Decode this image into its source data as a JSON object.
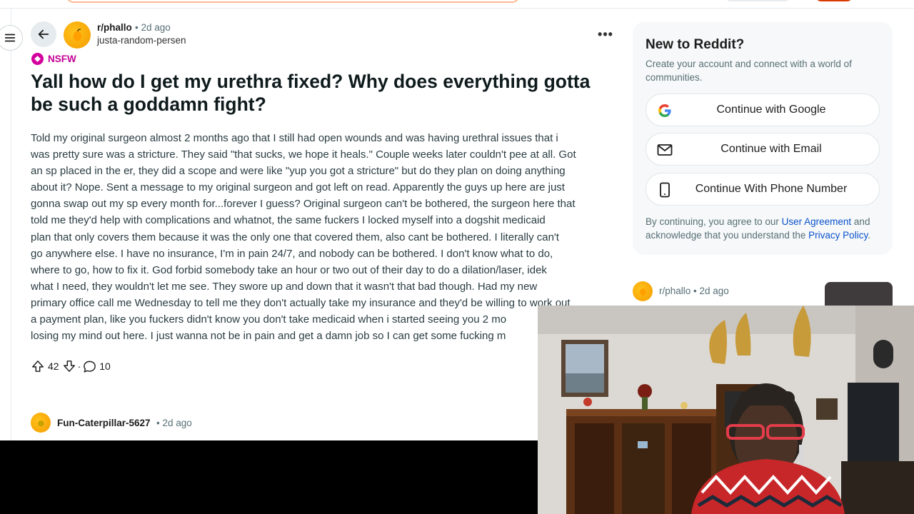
{
  "post": {
    "subreddit": "r/phallo",
    "time": "• 2d ago",
    "author": "justa-random-persen",
    "flair": "NSFW",
    "title": "Yall how do I get my urethra fixed? Why does everything gotta be such a goddamn fight?",
    "body": [
      "Told my original surgeon almost 2 months ago that I still had open wounds and was having urethral issues that i",
      "was pretty sure was a stricture. They said \"that sucks, we hope it heals.\" Couple weeks later couldn't pee at all. Got",
      "an sp placed in the er, they did a scope and were like \"yup you got a stricture\" but do they plan on doing anything",
      "about it? Nope. Sent a message to my original surgeon and got left on read. Apparently the guys up here are just",
      "gonna swap out my sp every month for...forever I guess? Original surgeon can't be bothered, the surgeon here that",
      "told me they'd help with complications and whatnot, the same fuckers I locked myself into a dogshit medicaid",
      "plan that only covers them because it was the only one that covered them, also cant be bothered. I literally can't",
      "go anywhere else. I have no insurance, I'm in pain 24/7, and nobody can be bothered. I don't know what to do,",
      "where to go, how to fix it. God forbid somebody take an hour or two out of their day to do a dilation/laser, idek",
      "what I need, they wouldn't let me see. They swore up and down that it wasn't that bad though. Had my new",
      "primary office call me Wednesday to tell me they don't actually take my insurance and they'd be willing to work out",
      "a payment plan, like you fuckers didn't know you don't take medicaid when i started seeing you 2 mo",
      "losing my mind out here. I just wanna not be in pain and get a damn job so I can get some fucking m"
    ],
    "votes": "42",
    "comments": "10",
    "separator": "·"
  },
  "comment": {
    "user": "Fun-Caterpillar-5627",
    "time": "• 2d ago"
  },
  "sidebar": {
    "title": "New to Reddit?",
    "description": "Create your account and connect with a world of communities.",
    "google_label": "Continue with Google",
    "email_label": "Continue with Email",
    "phone_label": "Continue With Phone Number",
    "legal_prefix": "By continuing, you agree to our ",
    "user_agreement": "User Agreement",
    "legal_middle": " and acknowledge that you understand the ",
    "privacy_policy": "Privacy Policy",
    "legal_suffix": "."
  },
  "related": {
    "subreddit": "r/phallo",
    "time": "• 2d ago"
  },
  "colors": {
    "nsfw": "#d3009e",
    "link": "#0a52cc",
    "avatar": "#ffb000"
  },
  "icons": [
    "menu-icon",
    "back-arrow-icon",
    "subreddit-avatar-icon",
    "more-options-icon",
    "nsfw-icon",
    "upvote-icon",
    "downvote-icon",
    "comment-icon",
    "google-icon",
    "email-icon",
    "phone-icon"
  ]
}
